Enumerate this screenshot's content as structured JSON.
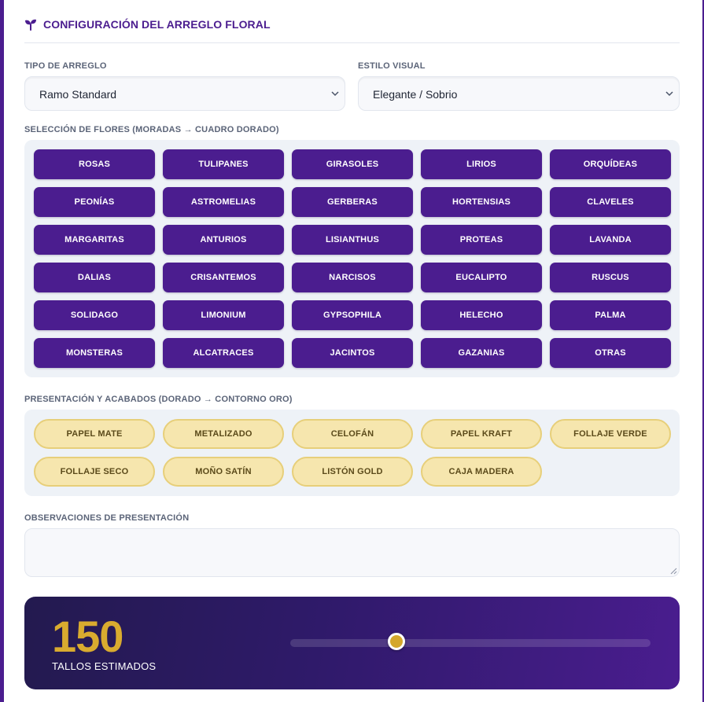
{
  "header": {
    "title": "CONFIGURACIÓN DEL ARREGLO FLORAL",
    "icon": "sprout-icon",
    "accent": "#4b1d8f"
  },
  "arrangement": {
    "type_label": "TIPO DE ARREGLO",
    "type_value": "Ramo Standard",
    "style_label": "ESTILO VISUAL",
    "style_value": "Elegante / Sobrio"
  },
  "flowers": {
    "label": "SELECCIÓN DE FLORES (MORADAS → CUADRO DORADO)",
    "items": [
      "ROSAS",
      "TULIPANES",
      "GIRASOLES",
      "LIRIOS",
      "ORQUÍDEAS",
      "PEONÍAS",
      "ASTROMELIAS",
      "GERBERAS",
      "HORTENSIAS",
      "CLAVELES",
      "MARGARITAS",
      "ANTURIOS",
      "LISIANTHUS",
      "PROTEAS",
      "LAVANDA",
      "DALIAS",
      "CRISANTEMOS",
      "NARCISOS",
      "EUCALIPTO",
      "RUSCUS",
      "SOLIDAGO",
      "LIMONIUM",
      "GYPSOPHILA",
      "HELECHO",
      "PALMA",
      "MONSTERAS",
      "ALCATRACES",
      "JACINTOS",
      "GAZANIAS",
      "OTRAS"
    ],
    "color": "#4b1d8f"
  },
  "presentation": {
    "label": "PRESENTACIÓN Y ACABADOS (DORADO → CONTORNO ORO)",
    "items": [
      "PAPEL MATE",
      "METALIZADO",
      "CELOFÁN",
      "PAPEL KRAFT",
      "FOLLAJE VERDE",
      "FOLLAJE SECO",
      "MOÑO SATÍN",
      "LISTÓN GOLD",
      "CAJA MADERA"
    ],
    "color": "#f6e6ae"
  },
  "observations": {
    "label": "OBSERVACIONES DE PRESENTACIÓN",
    "value": ""
  },
  "stems": {
    "value": "150",
    "label": "TALLOS ESTIMADOS",
    "slider_fraction": 0.3,
    "accent": "#d9ab2f"
  }
}
